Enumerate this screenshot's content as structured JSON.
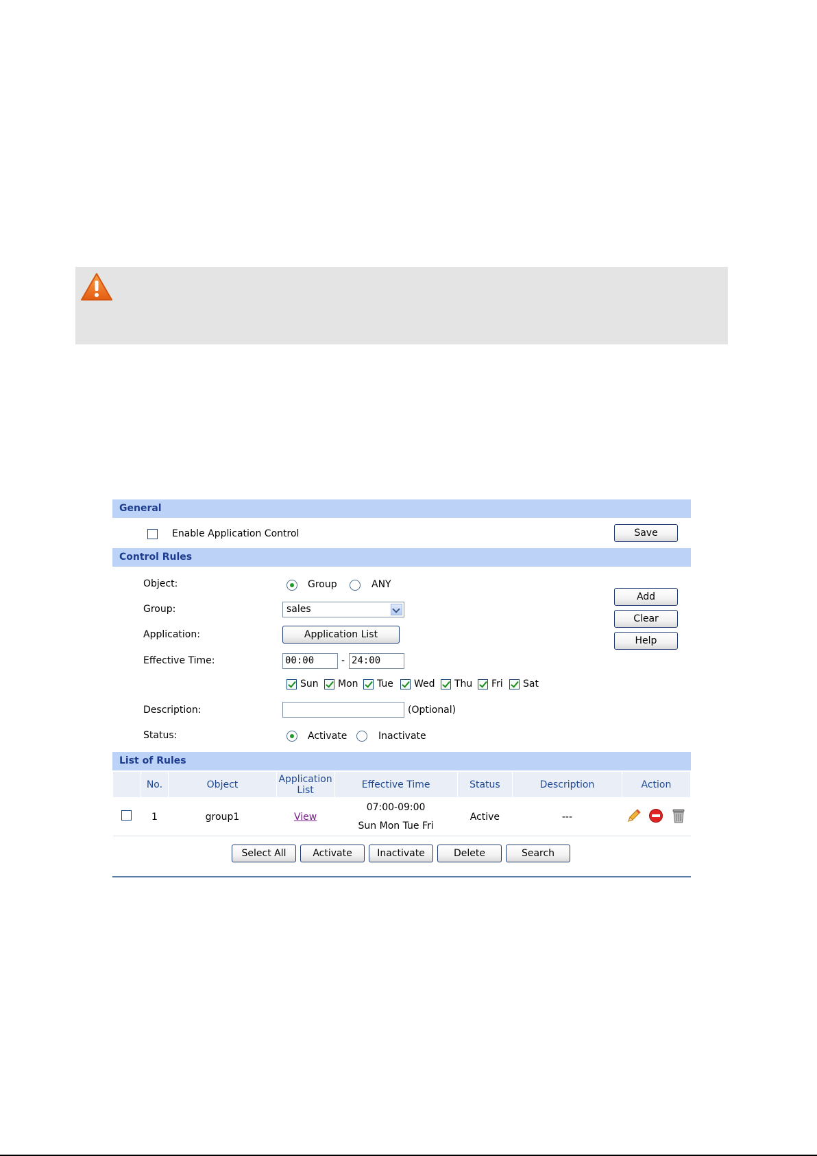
{
  "general": {
    "header": "General",
    "enable_label": "Enable Application Control",
    "enable_checked": false,
    "save_label": "Save"
  },
  "control_rules": {
    "header": "Control Rules",
    "object_label": "Object:",
    "object_options": [
      "Group",
      "ANY"
    ],
    "object_selected": "Group",
    "group_label": "Group:",
    "group_value": "sales",
    "application_label": "Application:",
    "application_button": "Application List",
    "effective_time_label": "Effective Time:",
    "time_start": "00:00",
    "time_sep": "-",
    "time_end": "24:00",
    "days": [
      "Sun",
      "Mon",
      "Tue",
      "Wed",
      "Thu",
      "Fri",
      "Sat"
    ],
    "description_label": "Description:",
    "description_value": "",
    "description_hint": "(Optional)",
    "status_label": "Status:",
    "status_options": [
      "Activate",
      "Inactivate"
    ],
    "status_selected": "Activate",
    "add_label": "Add",
    "clear_label": "Clear",
    "help_label": "Help"
  },
  "list_of_rules": {
    "header": "List of Rules",
    "columns": [
      "No.",
      "Object",
      "Application List",
      "Effective Time",
      "Status",
      "Description",
      "Action"
    ],
    "rows": [
      {
        "no": "1",
        "object": "group1",
        "application_list": "View",
        "time_range": "07:00-09:00",
        "time_days": "Sun Mon Tue Fri",
        "status": "Active",
        "description": "---"
      }
    ],
    "action_icons": [
      "edit-icon",
      "disable-icon",
      "delete-icon"
    ]
  },
  "bottom_buttons": {
    "select_all": "Select All",
    "activate": "Activate",
    "inactivate": "Inactivate",
    "delete": "Delete",
    "search": "Search"
  },
  "colors": {
    "section_bar": "#bcd3f7",
    "section_text": "#1f3d8f",
    "table_header": "#e9eef7",
    "link": "#7b1e8e",
    "check_green": "#1a8a1a",
    "warning_orange": "#f07a1e"
  }
}
